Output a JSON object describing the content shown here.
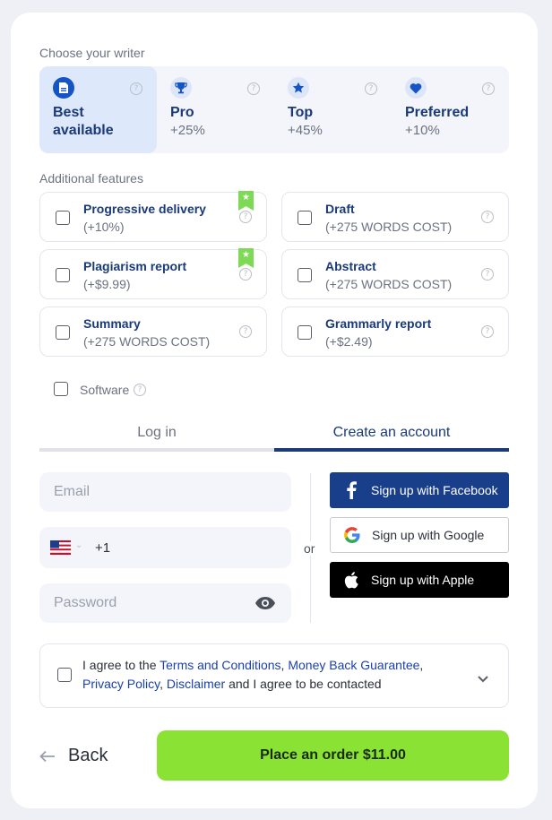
{
  "writer_section": {
    "label": "Choose your writer",
    "options": [
      {
        "name": "Best available",
        "price": "",
        "icon": "document-icon",
        "selected": true
      },
      {
        "name": "Pro",
        "price": "+25%",
        "icon": "trophy-icon",
        "selected": false
      },
      {
        "name": "Top",
        "price": "+45%",
        "icon": "star-icon",
        "selected": false
      },
      {
        "name": "Preferred",
        "price": "+10%",
        "icon": "heart-icon",
        "selected": false
      }
    ]
  },
  "features_section": {
    "label": "Additional features",
    "items": [
      {
        "title": "Progressive delivery",
        "sub": "(+10%)",
        "recommended": true
      },
      {
        "title": "Draft",
        "sub": "(+275 WORDS COST)",
        "recommended": false
      },
      {
        "title": "Plagiarism report",
        "sub": "(+$9.99)",
        "recommended": true
      },
      {
        "title": "Abstract",
        "sub": "(+275 WORDS COST)",
        "recommended": false
      },
      {
        "title": "Summary",
        "sub": "(+275 WORDS COST)",
        "recommended": false
      },
      {
        "title": "Grammarly report",
        "sub": "(+$2.49)",
        "recommended": false
      }
    ],
    "software_label": "Software"
  },
  "auth": {
    "tabs": [
      {
        "label": "Log in",
        "active": false
      },
      {
        "label": "Create an account",
        "active": true
      }
    ],
    "email_placeholder": "Email",
    "phone_code": "+1",
    "password_placeholder": "Password",
    "or_label": "or",
    "social": {
      "facebook": "Sign up with Facebook",
      "google": "Sign up with Google",
      "apple": "Sign up with Apple"
    }
  },
  "agreement": {
    "prefix": "I agree to the ",
    "terms": "Terms and Conditions",
    "comma1": ", ",
    "money_back": "Money Back Guarantee",
    "comma2": ",",
    "privacy": "Privacy Policy",
    "comma3": ", ",
    "disclaimer": "Disclaimer",
    "suffix": " and I agree to be contacted"
  },
  "footer": {
    "back_label": "Back",
    "order_label": "Place an order $11.00"
  },
  "colors": {
    "accent_blue": "#1554c4",
    "title_navy": "#1a3a78",
    "order_green": "#8ae234",
    "facebook_blue": "#1a3f8a"
  }
}
